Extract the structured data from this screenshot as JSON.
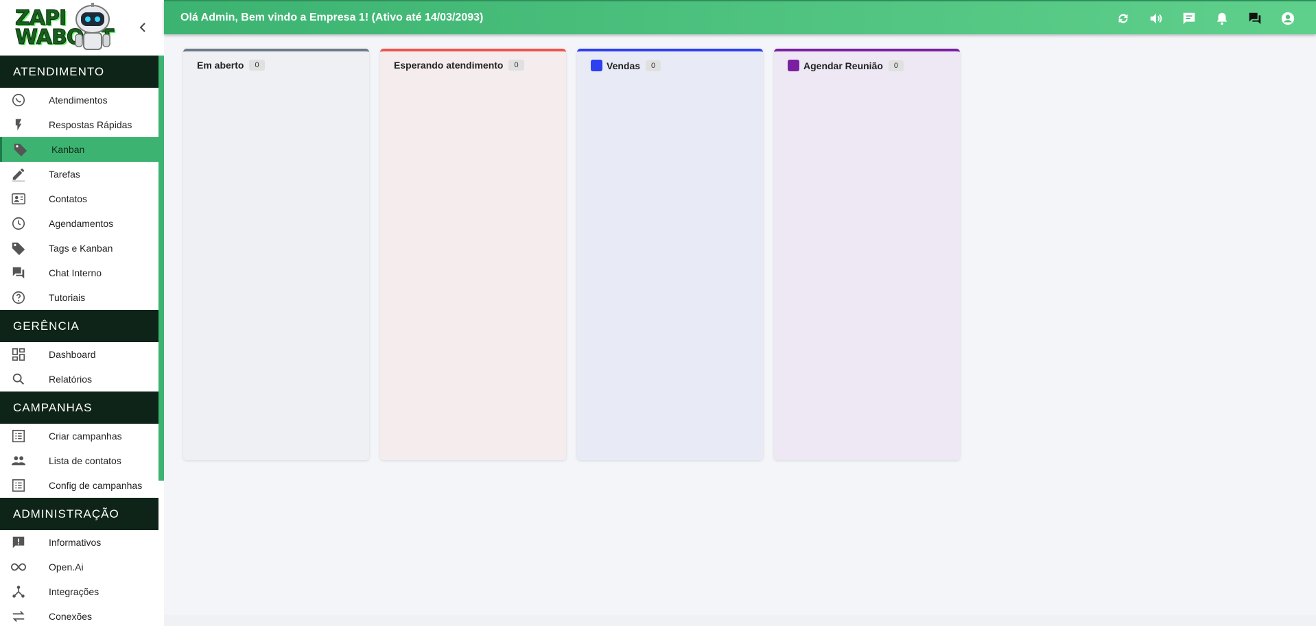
{
  "logo": {
    "line1": "ZAPI",
    "line2": "WABOOT"
  },
  "colors": {
    "accent": "#3cb371",
    "section_bg": "#0e2418"
  },
  "header": {
    "greeting": "Olá Admin, Bem vindo a Empresa 1! (Ativo até 14/03/2093)",
    "icons": [
      "refresh-icon",
      "volume-icon",
      "chat-icon",
      "bell-icon",
      "forum-icon",
      "account-icon"
    ]
  },
  "sections": [
    {
      "title": "ATENDIMENTO",
      "items": [
        {
          "label": "Atendimentos",
          "icon": "whatsapp-icon"
        },
        {
          "label": "Respostas Rápidas",
          "icon": "flash-icon"
        },
        {
          "label": "Kanban",
          "icon": "tag-icon",
          "active": true
        },
        {
          "label": "Tarefas",
          "icon": "pencil-icon"
        },
        {
          "label": "Contatos",
          "icon": "contact-card-icon"
        },
        {
          "label": "Agendamentos",
          "icon": "clock-icon"
        },
        {
          "label": "Tags e Kanban",
          "icon": "tag-icon"
        },
        {
          "label": "Chat Interno",
          "icon": "forum-icon"
        },
        {
          "label": "Tutoriais",
          "icon": "help-circle-icon"
        }
      ]
    },
    {
      "title": "GERÊNCIA",
      "items": [
        {
          "label": "Dashboard",
          "icon": "dashboard-icon"
        },
        {
          "label": "Relatórios",
          "icon": "search-icon"
        }
      ]
    },
    {
      "title": "CAMPANHAS",
      "items": [
        {
          "label": "Criar campanhas",
          "icon": "list-icon"
        },
        {
          "label": "Lista de contatos",
          "icon": "people-icon"
        },
        {
          "label": "Config de campanhas",
          "icon": "list-icon"
        }
      ]
    },
    {
      "title": "ADMINISTRAÇÃO",
      "items": [
        {
          "label": "Informativos",
          "icon": "announcement-icon"
        },
        {
          "label": "Open.Ai",
          "icon": "infinity-icon"
        },
        {
          "label": "Integrações",
          "icon": "hub-icon"
        },
        {
          "label": "Conexões",
          "icon": "swap-icon"
        }
      ]
    }
  ],
  "lanes": [
    {
      "title": "Em aberto",
      "count": "0",
      "color": "#6c7a89",
      "bg": "#eff0f4",
      "dot": false
    },
    {
      "title": "Esperando atendimento",
      "count": "0",
      "color": "#ef5350",
      "bg": "#f5ecee",
      "dot": false
    },
    {
      "title": "Vendas",
      "count": "0",
      "color": "#2d3ff0",
      "bg": "#e8ebf6",
      "dot": true
    },
    {
      "title": "Agendar Reunião",
      "count": "0",
      "color": "#7b1fa2",
      "bg": "#ede8f3",
      "dot": true
    }
  ]
}
